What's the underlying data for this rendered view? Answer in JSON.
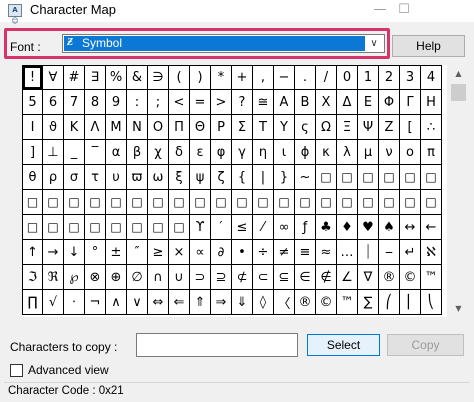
{
  "window": {
    "title": "Character Map",
    "icon": "character-map-app-icon",
    "icon_text": "A☺",
    "minimize_glyph": "—",
    "maximize_glyph": "☐"
  },
  "font": {
    "label": "Font :",
    "selected": "Symbol",
    "font_type_icon": "opentype-font-icon",
    "font_type_glyph": "Ƶ",
    "chevron_glyph": "∨",
    "highlight_color": "#d6336c",
    "selection_color": "#0a78d4"
  },
  "help_label": "Help",
  "grid": {
    "columns": 20,
    "selected_index": 0,
    "rows": [
      [
        "!",
        "∀",
        "#",
        "∃",
        "%",
        "&",
        "∋",
        "(",
        ")",
        "*",
        "+",
        ",",
        "−",
        ".",
        "/",
        "0",
        "1",
        "2",
        "3",
        "4"
      ],
      [
        "5",
        "6",
        "7",
        "8",
        "9",
        ":",
        ";",
        "<",
        "=",
        ">",
        "?",
        "≅",
        "Α",
        "Β",
        "Χ",
        "Δ",
        "Ε",
        "Φ",
        "Γ",
        "Η"
      ],
      [
        "Ι",
        "ϑ",
        "Κ",
        "Λ",
        "Μ",
        "Ν",
        "Ο",
        "Π",
        "Θ",
        "Ρ",
        "Σ",
        "Τ",
        "Υ",
        "ς",
        "Ω",
        "Ξ",
        "Ψ",
        "Ζ",
        "[",
        "∴"
      ],
      [
        "]",
        "⊥",
        "_",
        "‾",
        "α",
        "β",
        "χ",
        "δ",
        "ε",
        "φ",
        "γ",
        "η",
        "ι",
        "ϕ",
        "κ",
        "λ",
        "μ",
        "ν",
        "ο",
        "π"
      ],
      [
        "θ",
        "ρ",
        "σ",
        "τ",
        "υ",
        "ϖ",
        "ω",
        "ξ",
        "ψ",
        "ζ",
        "{",
        "|",
        "}",
        "~",
        "□",
        "□",
        "□",
        "□",
        "□",
        "□"
      ],
      [
        "□",
        "□",
        "□",
        "□",
        "□",
        "□",
        "□",
        "□",
        "□",
        "□",
        "□",
        "□",
        "□",
        "□",
        "□",
        "□",
        "□",
        "□",
        "□",
        "□"
      ],
      [
        "□",
        "□",
        "□",
        "□",
        "□",
        "□",
        "□",
        "□",
        "ϒ",
        "′",
        "≤",
        "⁄",
        "∞",
        "ƒ",
        "♣",
        "♦",
        "♥",
        "♠",
        "↔",
        "←"
      ],
      [
        "↑",
        "→",
        "↓",
        "°",
        "±",
        "″",
        "≥",
        "×",
        "∝",
        "∂",
        "•",
        "÷",
        "≠",
        "≡",
        "≈",
        "…",
        "⏐",
        "⎯",
        "↵",
        "ℵ"
      ],
      [
        "ℑ",
        "ℜ",
        "℘",
        "⊗",
        "⊕",
        "∅",
        "∩",
        "∪",
        "⊃",
        "⊇",
        "⊄",
        "⊂",
        "⊆",
        "∈",
        "∉",
        "∠",
        "∇",
        "®",
        "©",
        "™"
      ],
      [
        "∏",
        "√",
        "⋅",
        "¬",
        "∧",
        "∨",
        "⇔",
        "⇐",
        "⇑",
        "⇒",
        "⇓",
        "◊",
        "〈",
        "®",
        "©",
        "™",
        "∑",
        "⎛",
        "⎜",
        "⎝"
      ]
    ]
  },
  "scrollbar": {
    "up_arrow": "▲",
    "down_arrow": "▼"
  },
  "copy": {
    "label": "Characters to copy :",
    "value": "",
    "select_label": "Select",
    "copy_label": "Copy"
  },
  "advanced": {
    "label": "Advanced view",
    "checked": false
  },
  "status": {
    "text": "Character Code : 0x21"
  }
}
